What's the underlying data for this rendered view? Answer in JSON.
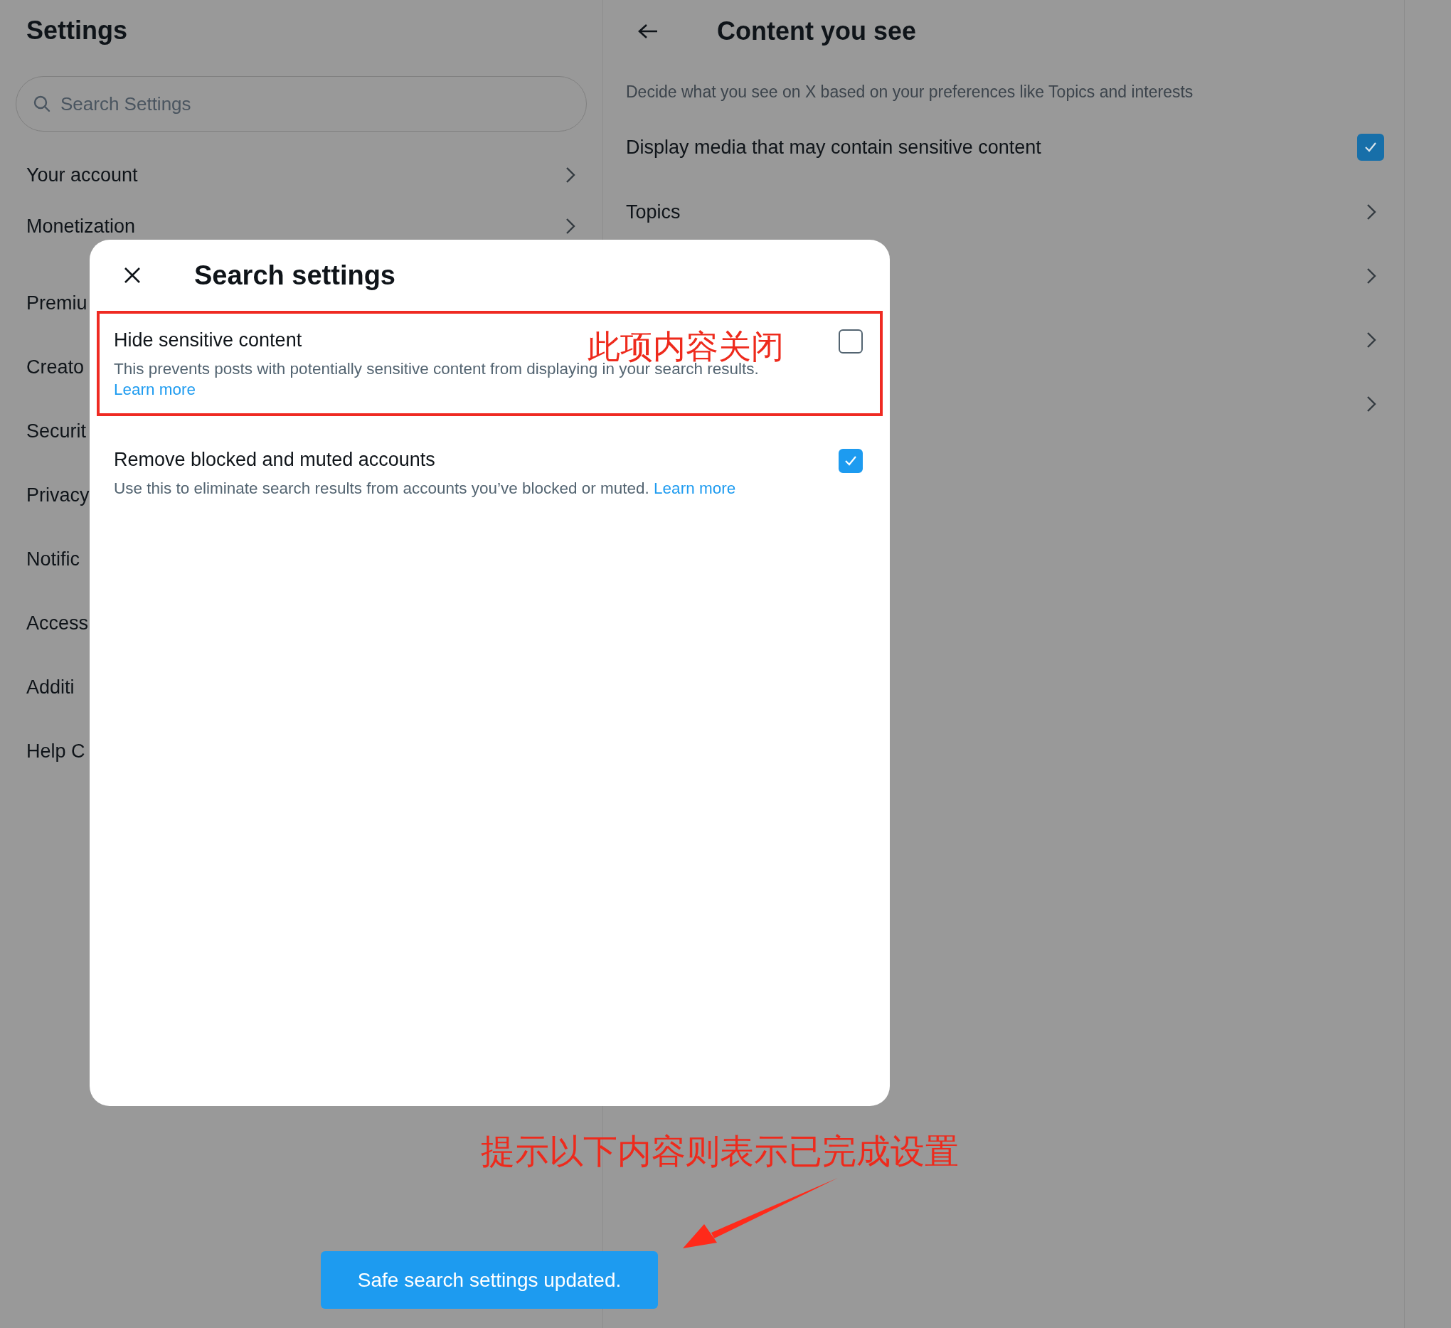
{
  "sidebar": {
    "title": "Settings",
    "search": {
      "placeholder": "Search Settings"
    },
    "items": [
      {
        "label": "Your account",
        "chevron": true
      },
      {
        "label": "Monetization",
        "chevron": true
      },
      {
        "label": "Premiu",
        "chevron": false
      },
      {
        "label": "Creato",
        "chevron": false
      },
      {
        "label": "Securit",
        "chevron": false
      },
      {
        "label": "Privacy",
        "chevron": false
      },
      {
        "label": "Notific",
        "chevron": false
      },
      {
        "label": "Access",
        "chevron": false
      },
      {
        "label": "Additi",
        "chevron": false
      },
      {
        "label": "Help C",
        "chevron": false
      }
    ]
  },
  "content": {
    "title": "Content you see",
    "description": "Decide what you see on X based on your preferences like Topics and interests",
    "rows": [
      {
        "kind": "checkbox",
        "label": "Display media that may contain sensitive content",
        "checked": true
      },
      {
        "kind": "link",
        "label": "Topics"
      },
      {
        "kind": "link"
      },
      {
        "kind": "link"
      },
      {
        "kind": "link"
      }
    ]
  },
  "dialog": {
    "title": "Search settings",
    "options": [
      {
        "label": "Hide sensitive content",
        "description": "This prevents posts with potentially sensitive content from displaying in your search results.",
        "link": "Learn more",
        "checked": false,
        "highlighted": true
      },
      {
        "label": "Remove blocked and muted accounts",
        "description": "Use this to eliminate search results from accounts you’ve blocked or muted.",
        "link": "Learn more",
        "checked": true,
        "highlighted": false
      }
    ]
  },
  "annotations": [
    {
      "text": "此项内容关闭"
    },
    {
      "text": "提示以下内容则表示已完成设置"
    }
  ],
  "toast": "Safe search settings updated."
}
